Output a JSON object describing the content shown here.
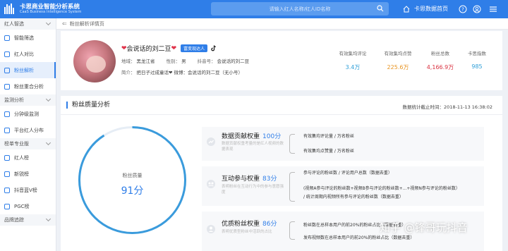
{
  "app": {
    "title": "卡思商业智能分析系统",
    "subtitle": "CaaS Business Intelligence System",
    "search_placeholder": "请输入红人名称/红人ID名称",
    "home_link": "卡思数据首页"
  },
  "sidebar": {
    "sections": [
      {
        "label": "红人智选",
        "items": [
          {
            "label": "智能筛选",
            "icon": "filter-icon"
          },
          {
            "label": "红人对比",
            "icon": "compare-icon"
          },
          {
            "label": "粉丝解析",
            "icon": "fans-icon",
            "active": true
          },
          {
            "label": "粉丝重合分析",
            "icon": "overlap-icon"
          }
        ]
      },
      {
        "label": "监测分析",
        "items": [
          {
            "label": "分钟级监测",
            "icon": "clock-icon"
          },
          {
            "label": "平台红人分布",
            "icon": "distribution-icon"
          }
        ]
      },
      {
        "label": "榜单专业版",
        "items": [
          {
            "label": "红人榜",
            "icon": "rank-icon"
          },
          {
            "label": "新锐榜",
            "icon": "new-icon"
          },
          {
            "label": "抖音蓝V榜",
            "icon": "bluev-icon"
          },
          {
            "label": "PGC榜",
            "icon": "pgc-icon"
          }
        ]
      },
      {
        "label": "品牌追踪",
        "items": []
      }
    ]
  },
  "breadcrumb": "粉丝解析详情页",
  "profile": {
    "name": "会说话的刘二豆",
    "name_prefix": "❤",
    "name_suffix": "❤",
    "badge": "富变现达人",
    "region_label": "地域：",
    "region": "黑龙江省",
    "gender_label": "性别：",
    "gender": "男",
    "douyin_label": "抖音号：",
    "douyin": "会说话的刘二豆",
    "intro_label": "简介：",
    "intro": "把日子过成童话❤ 微博：会说话的刘二豆（无小号）",
    "stats": [
      {
        "label": "有效集均评论",
        "value": "3.4万",
        "color": "#2f9fd8"
      },
      {
        "label": "有效集均点赞",
        "value": "225.6万",
        "color": "#e8931f"
      },
      {
        "label": "粉丝总数",
        "value": "4,166.9万",
        "color": "#d9303f"
      },
      {
        "label": "卡思指数",
        "value": "985",
        "color": "#2f9fd8"
      }
    ]
  },
  "quality": {
    "title": "粉丝质量分析",
    "date_label": "数据统计截止时间：",
    "date": "2018-11-13 16:38:02",
    "score_label": "粉丝质量",
    "score_value": "91分",
    "score_fraction": 0.91,
    "ring_color": "#3a9bdc",
    "metrics": [
      {
        "name": "数据贡献权重",
        "weight": "100分",
        "icon": "contribution-icon",
        "desc": "数据贡献权重考量的是红人视频的数据表现",
        "formulas": [
          "有效集均评论量 / 万名粉丝",
          "有效集均点赞量 / 万名粉丝"
        ]
      },
      {
        "name": "互动参与权重",
        "weight": "83分",
        "icon": "interaction-icon",
        "desc": "表明粉丝在互动行为中的参与意愿强度",
        "formulas": [
          "参与评论的粉丝数 / 评论用户总数（数据去重）",
          "(视频A参与评论的粉丝数+视频B参与评论的粉丝数+...+视频N参与评论的粉丝数）",
          "/ 统计周期内视频所有参与评论的粉丝数（数据去重）"
        ]
      },
      {
        "name": "优质粉丝权重",
        "weight": "86分",
        "icon": "premium-fans-icon",
        "desc": "表明优质型粉丝中活跃的占比",
        "formulas": [
          "粉丝数在总样本用户的前20%的粉丝占比（数据去重）",
          "发布视频数在总样本用户的前20%的粉丝占比（数据去重）"
        ]
      }
    ]
  },
  "watermark": "知乎 @锋哥玩抖音"
}
